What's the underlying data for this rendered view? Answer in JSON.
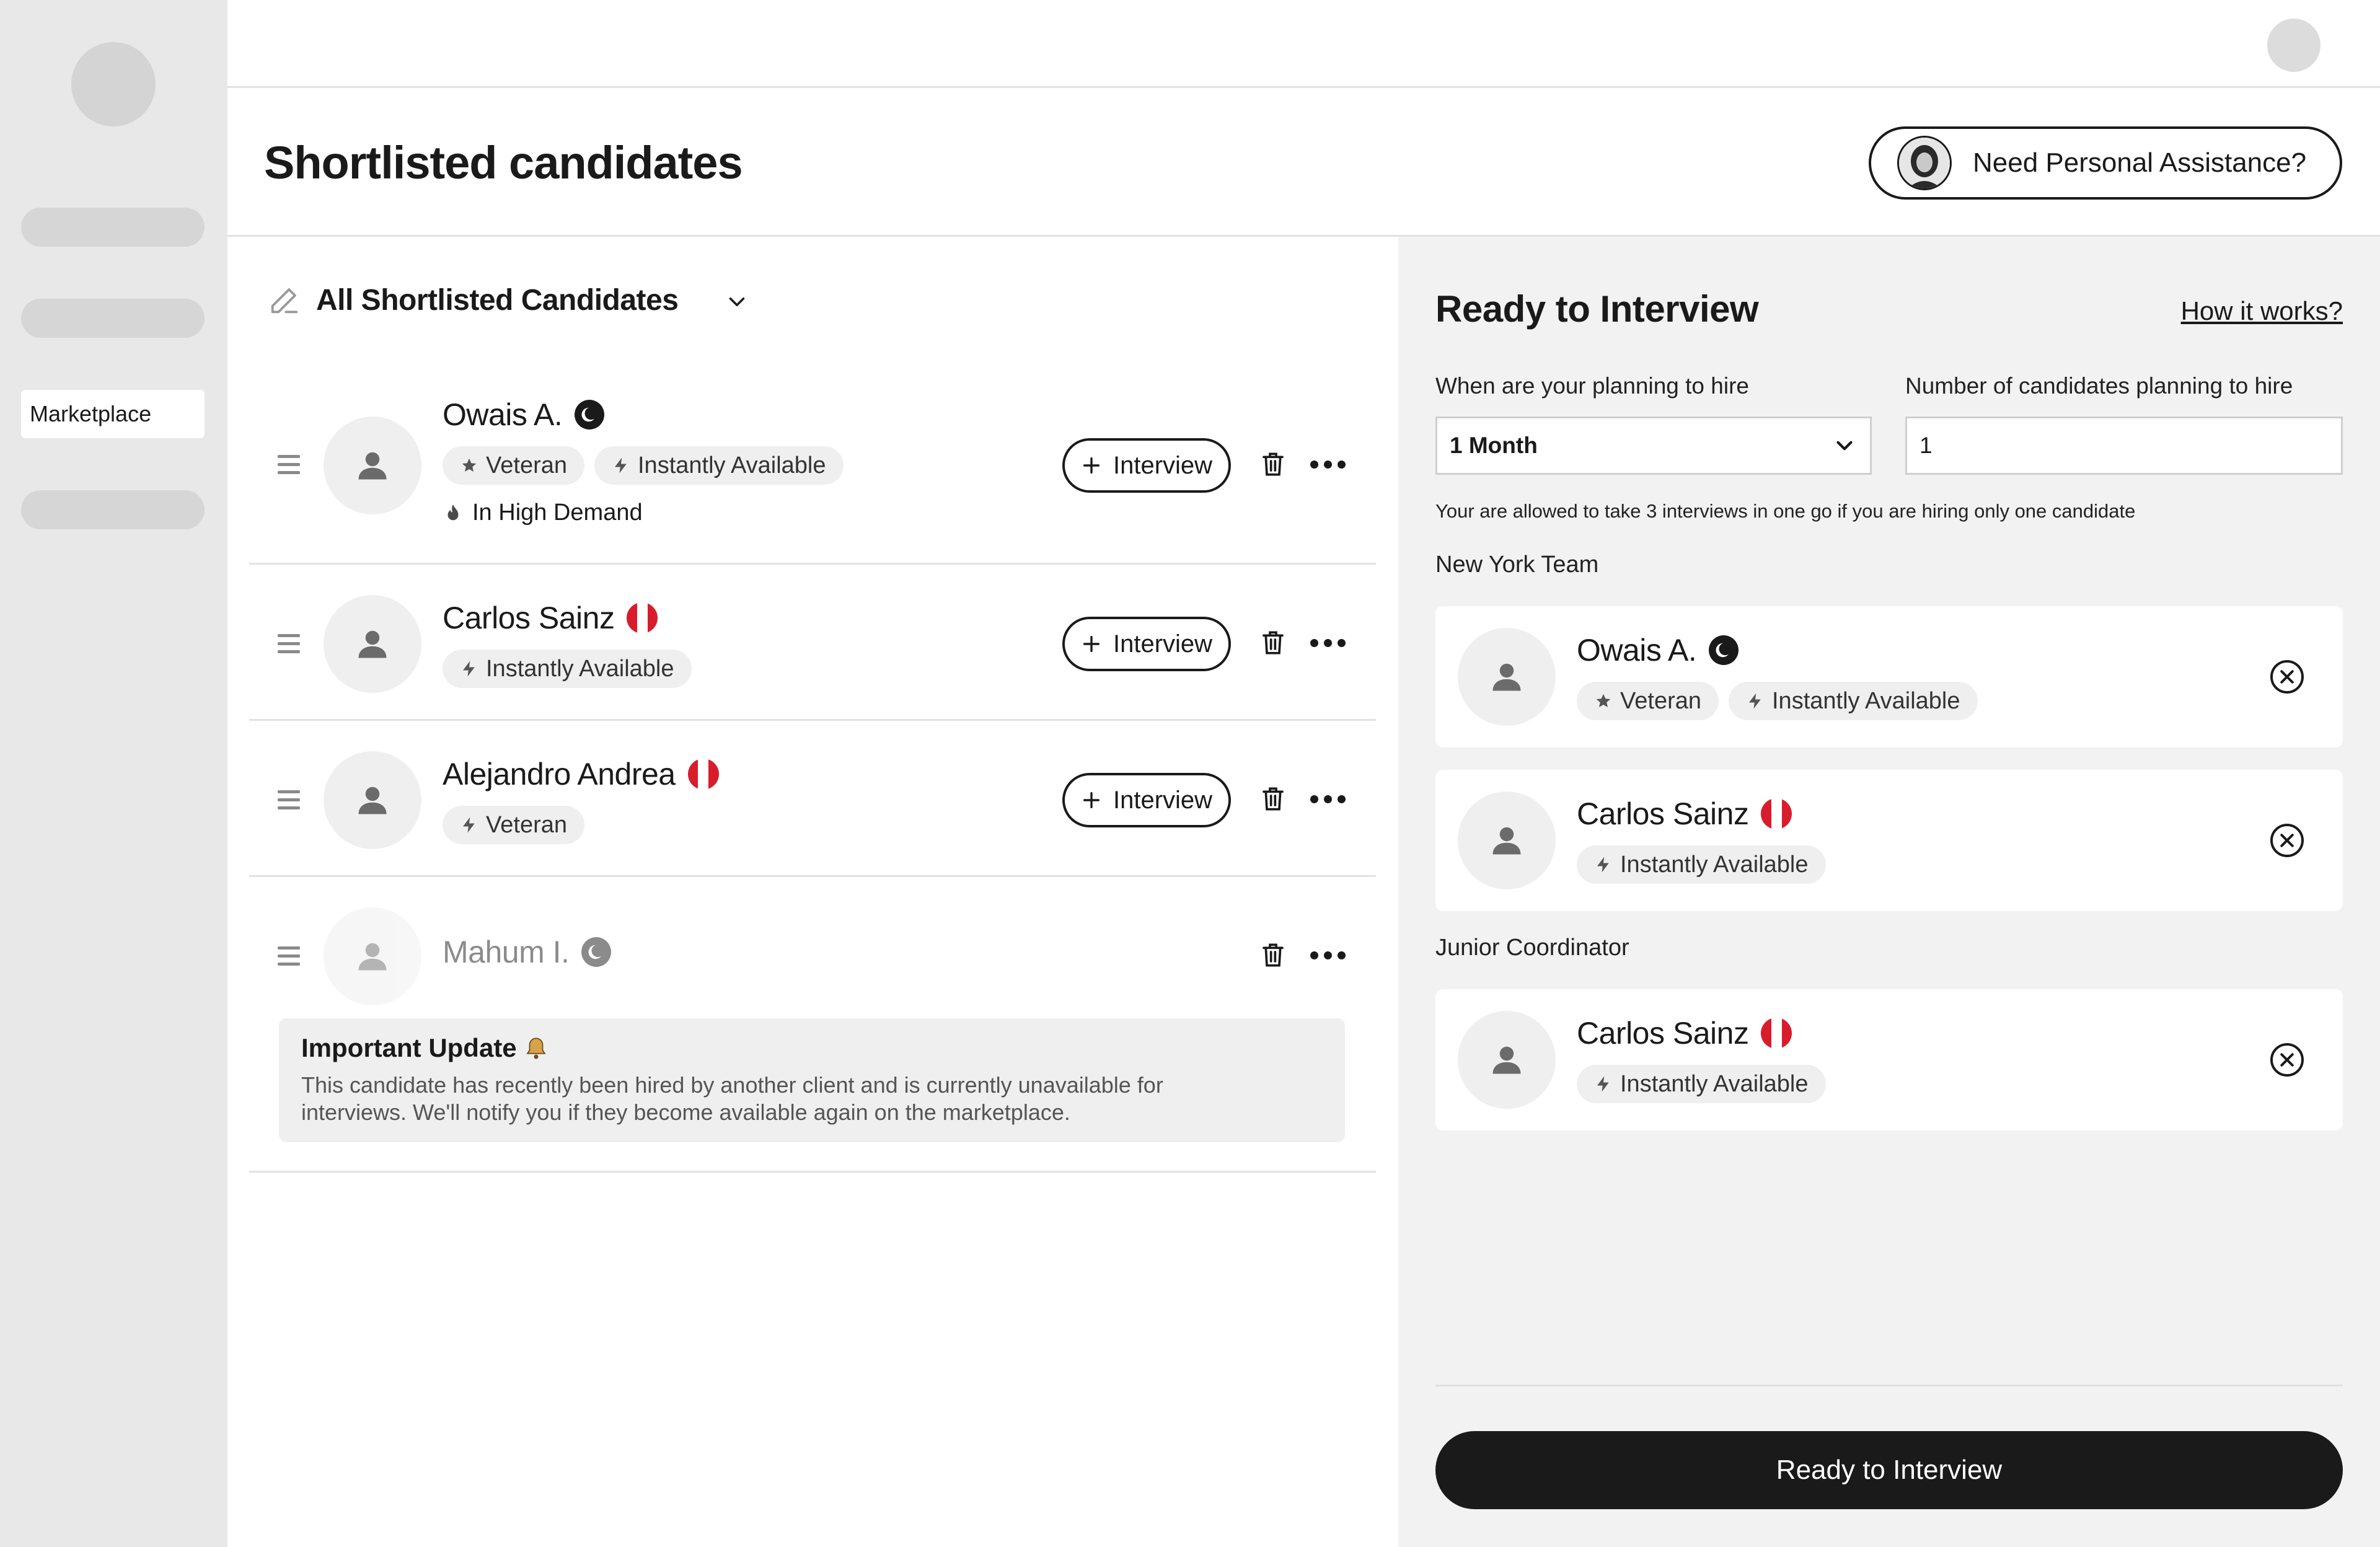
{
  "sidebar": {
    "active_item_label": "Marketplace"
  },
  "header": {
    "title": "Shortlisted candidates",
    "assist_button_label": "Need Personal Assistance?"
  },
  "list": {
    "title": "All Shortlisted Candidates",
    "candidates": [
      {
        "name": "Owais A.",
        "flag": "crescent",
        "tags": [
          "Veteran",
          "Instantly Available"
        ],
        "extra": "In High Demand",
        "interview_label": "Interview"
      },
      {
        "name": "Carlos Sainz",
        "flag": "peru",
        "tags": [
          "Instantly Available"
        ],
        "interview_label": "Interview"
      },
      {
        "name": "Alejandro Andrea",
        "flag": "peru",
        "tags": [
          "Veteran"
        ],
        "interview_label": "Interview"
      },
      {
        "name": "Mahum I.",
        "flag": "crescent",
        "unavailable": true
      }
    ],
    "update": {
      "title": "Important Update",
      "text": "This candidate has recently been hired by another client and is currently unavailable for interviews. We'll notify you if they become available again on the marketplace."
    }
  },
  "ready_panel": {
    "title": "Ready to Interview",
    "how_link": "How it works?",
    "hire_time_label": "When are your planning to hire",
    "hire_time_value": "1 Month",
    "count_label": "Number of candidates planning to hire",
    "count_value": "1",
    "note": "Your are allowed to take 3 interviews in one go if you are hiring only one candidate",
    "groups": [
      {
        "name": "New York Team",
        "candidates": [
          {
            "name": "Owais A.",
            "flag": "crescent",
            "tags": [
              "Veteran",
              "Instantly Available"
            ]
          },
          {
            "name": "Carlos Sainz",
            "flag": "peru",
            "tags": [
              "Instantly Available"
            ]
          }
        ]
      },
      {
        "name": "Junior Coordinator",
        "candidates": [
          {
            "name": "Carlos Sainz",
            "flag": "peru",
            "tags": [
              "Instantly Available"
            ]
          }
        ]
      }
    ],
    "cta_label": "Ready to Interview"
  },
  "colors": {
    "sidebar_bg": "#e8e8e8",
    "panel_bg": "#f2f2f2",
    "text": "#1a1a1a",
    "flag_red": "#d91c2c",
    "cta_bg": "#1a1a1a"
  }
}
